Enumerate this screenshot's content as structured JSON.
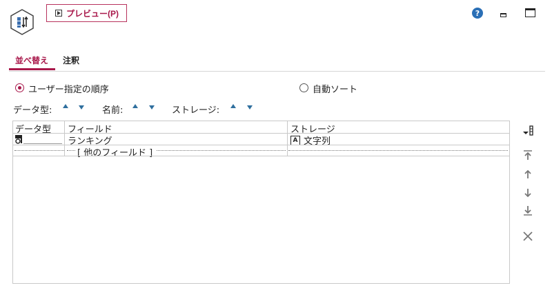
{
  "header": {
    "preview_button_label": "プレビュー(P)"
  },
  "help_glyph": "?",
  "tabs": [
    {
      "label": "並べ替え",
      "active": true
    },
    {
      "label": "注釈",
      "active": false
    }
  ],
  "sort_mode": {
    "options": [
      {
        "label": "ユーザー指定の順序",
        "selected": true
      },
      {
        "label": "自動ソート",
        "selected": false
      }
    ]
  },
  "sort_keys": [
    {
      "label": "データ型:"
    },
    {
      "label": "名前:"
    },
    {
      "label": "ストレージ:"
    }
  ],
  "table": {
    "columns": [
      "データ型",
      "フィールド",
      "ストレージ"
    ],
    "rows": [
      {
        "type_icon": "flag-type-icon",
        "field": "ランキング",
        "storage_icon": "string-storage-icon",
        "storage_icon_glyph": "A",
        "storage": "文字列"
      }
    ],
    "other_fields_label": "[ 他のフィールド ]"
  },
  "toolbar": {
    "icons": [
      "field-reorder-icon",
      "move-to-top-icon",
      "move-up-icon",
      "move-down-icon",
      "move-to-bottom-icon",
      "delete-icon"
    ]
  },
  "colors": {
    "accent": "#a8174a",
    "help": "#2a6fb6",
    "sort_arrow": "#2f6f9e"
  }
}
